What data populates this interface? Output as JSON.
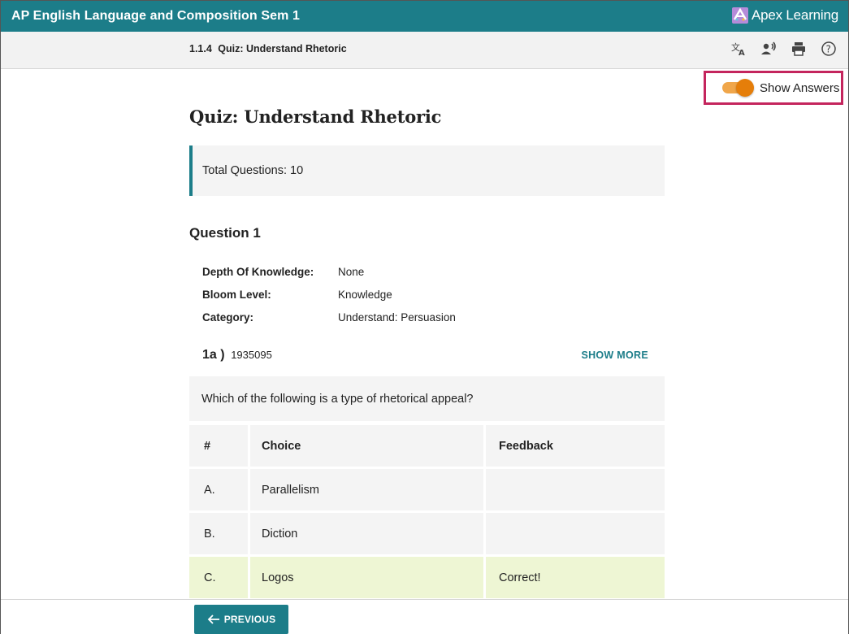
{
  "header": {
    "course_title": "AP English Language and Composition Sem 1",
    "brand": "Apex Learning"
  },
  "subbar": {
    "lesson_number": "1.1.4",
    "lesson_title": "Quiz:  Understand Rhetoric",
    "tools": [
      "translate-icon",
      "text-to-speech-icon",
      "print-icon",
      "help-icon"
    ]
  },
  "answers_toggle": {
    "label": "Show Answers",
    "on": true
  },
  "quiz": {
    "title": "Quiz: Understand Rhetoric",
    "total_questions": "Total Questions: 10",
    "question_heading": "Question 1",
    "meta": [
      {
        "key": "Depth Of Knowledge:",
        "value": "None"
      },
      {
        "key": "Bloom Level:",
        "value": "Knowledge"
      },
      {
        "key": "Category:",
        "value": "Understand: Persuasion"
      }
    ],
    "part": "1a )",
    "item_id": "1935095",
    "show_more": "SHOW MORE",
    "prompt": "Which of the following is a type of rhetorical appeal?",
    "table_headers": [
      "#",
      "Choice",
      "Feedback"
    ],
    "choices": [
      {
        "letter": "A.",
        "text": "Parallelism",
        "feedback": ""
      },
      {
        "letter": "B.",
        "text": "Diction",
        "feedback": ""
      },
      {
        "letter": "C.",
        "text": "Logos",
        "feedback": "Correct!"
      }
    ]
  },
  "footer": {
    "previous_label": "PREVIOUS"
  },
  "colors": {
    "teal": "#1c7d89",
    "toggle_orange": "#e57e0a",
    "highlight_border": "#c4255d",
    "correct_row": "#eef6d4"
  }
}
